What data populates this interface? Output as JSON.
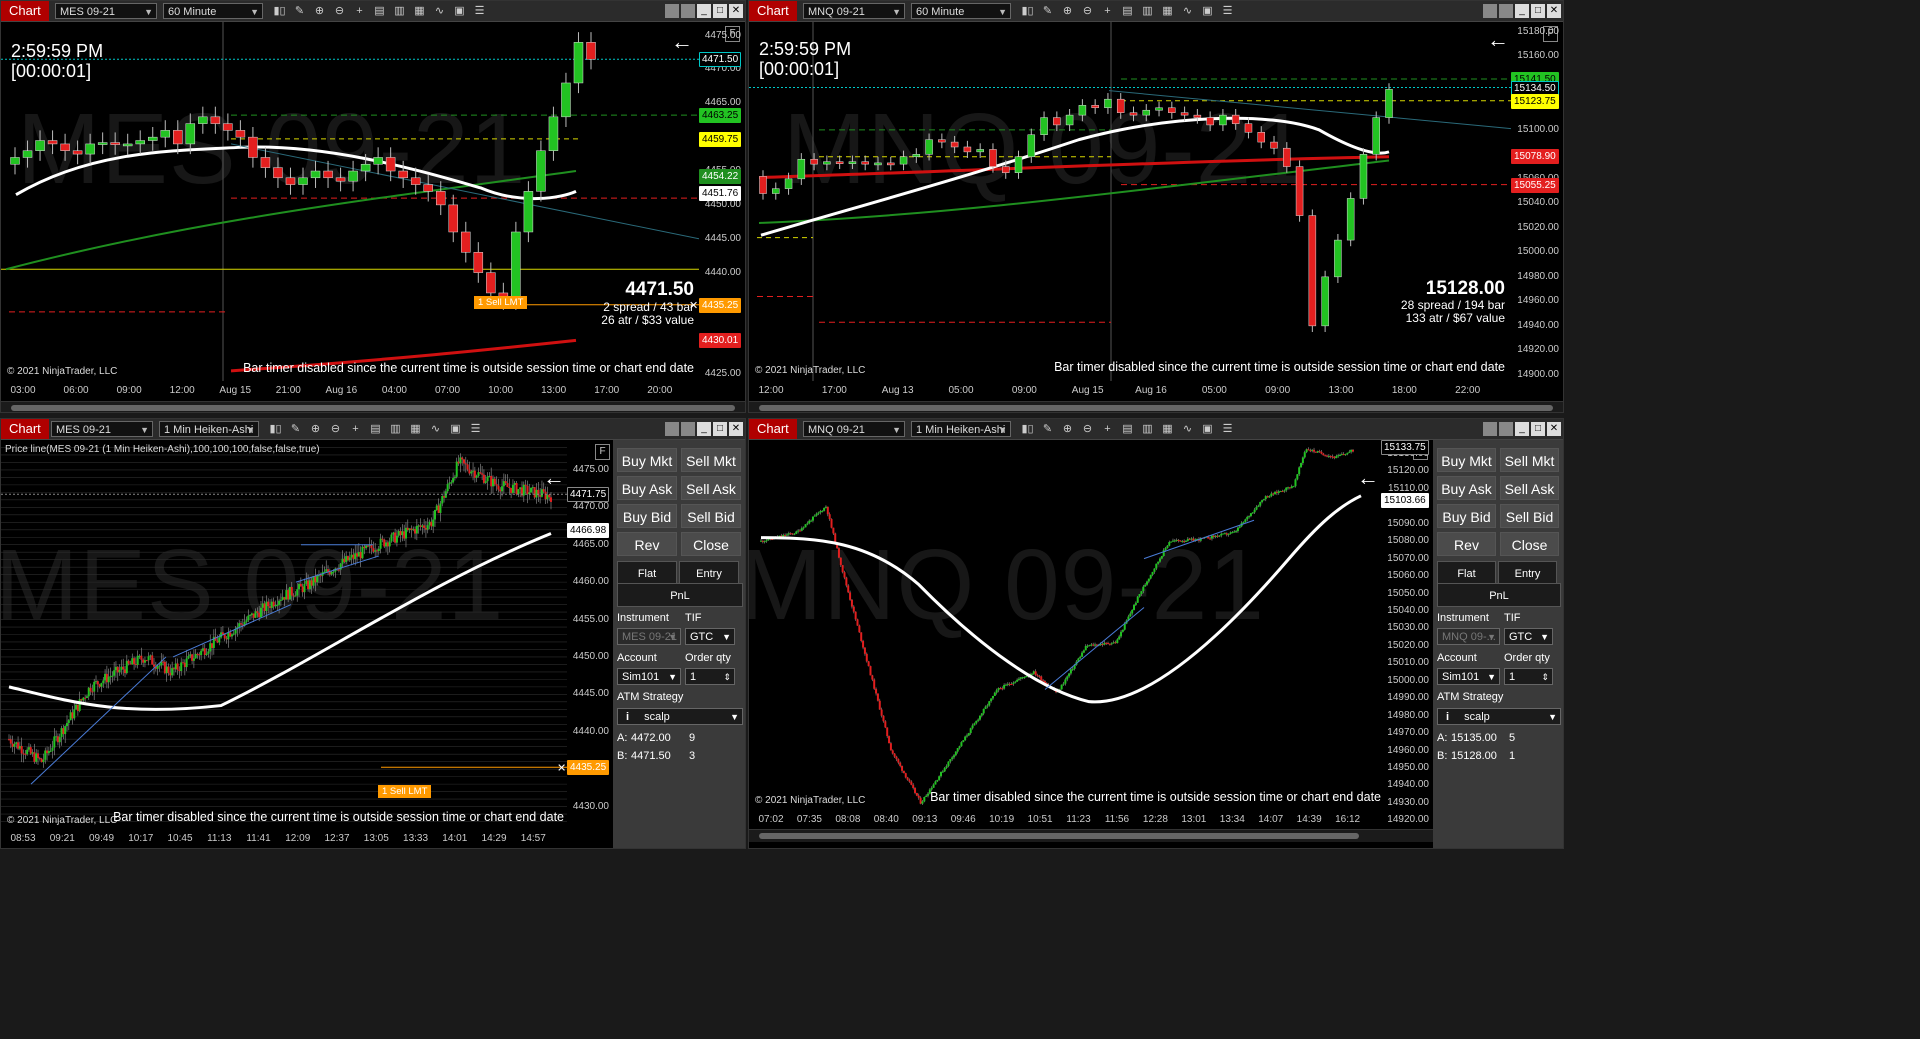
{
  "colors": {
    "up": "#22c322",
    "down": "#e31f1f",
    "accent": "#b00000",
    "order": "#ff9a00",
    "sma": "#ffffff",
    "green_line": "#1f8f1f",
    "red_line": "#d01010",
    "yellow": "#d7d700",
    "cyan": "#00c8c8"
  },
  "toolbar_icons": [
    "bar-type-icon",
    "pencil-icon",
    "zoom-in-icon",
    "zoom-out-icon",
    "crosshair-icon",
    "properties-icon",
    "templates-icon",
    "strategies-icon",
    "indicators-icon",
    "data-box-icon",
    "list-icon"
  ],
  "panels": [
    {
      "title": "Chart",
      "instrument": "MES 09-21",
      "period": "60 Minute",
      "clock": "2:59:59 PM",
      "countdown": "[00:00:01]",
      "watermark": "MES 09-21",
      "last_price": "4471.50",
      "spread_info": "2 spread / 43 bar",
      "atr_info": "26 atr / $33 value",
      "copyright": "© 2021 NinjaTrader, LLC",
      "bar_timer": "Bar timer disabled since the current time is outside session time or chart end date",
      "order_label": "1 Sell LMT",
      "y_ticks": [
        "4475.00",
        "4470.00",
        "4465.00",
        "4460.00",
        "4455.00",
        "4450.00",
        "4445.00",
        "4440.00",
        "4435.00",
        "4430.00",
        "4425.00"
      ],
      "x_ticks": [
        "03:00",
        "06:00",
        "09:00",
        "12:00",
        "Aug 15",
        "21:00",
        "Aug 16",
        "04:00",
        "07:00",
        "10:00",
        "13:00",
        "17:00",
        "20:00"
      ],
      "price_tags": [
        {
          "label": "4471.50",
          "value": 4471.5,
          "bg": "#000",
          "fg": "#fff",
          "border": "#00c8c8"
        },
        {
          "label": "4463.25",
          "value": 4463.25,
          "bg": "#22c322",
          "fg": "#000",
          "border": "#22c322"
        },
        {
          "label": "4459.75",
          "value": 4459.75,
          "bg": "#ffff00",
          "fg": "#000",
          "border": "#ffff00"
        },
        {
          "label": "4454.22",
          "value": 4454.22,
          "bg": "#1f8f1f",
          "fg": "#fff",
          "border": "#1f8f1f"
        },
        {
          "label": "4451.76",
          "value": 4451.76,
          "bg": "#fff",
          "fg": "#000",
          "border": "#fff"
        },
        {
          "label": "4435.25",
          "value": 4435.25,
          "bg": "#ff9a00",
          "fg": "#fff",
          "border": "#ff9a00"
        },
        {
          "label": "4430.01",
          "value": 4430.01,
          "bg": "#e31f1f",
          "fg": "#fff",
          "border": "#e31f1f"
        }
      ]
    },
    {
      "title": "Chart",
      "instrument": "MNQ 09-21",
      "period": "60 Minute",
      "clock": "2:59:59 PM",
      "countdown": "[00:00:01]",
      "watermark": "MNQ 09-21",
      "last_price": "15128.00",
      "spread_info": "28 spread / 194 bar",
      "atr_info": "133 atr / $67 value",
      "copyright": "© 2021 NinjaTrader, LLC",
      "bar_timer": "Bar timer disabled since the current time is outside session time or chart end date",
      "y_ticks": [
        "15180.00",
        "15160.00",
        "15120.00",
        "15100.00",
        "15060.00",
        "15040.00",
        "15020.00",
        "15000.00",
        "14980.00",
        "14960.00",
        "14940.00",
        "14920.00",
        "14900.00"
      ],
      "x_ticks": [
        "12:00",
        "17:00",
        "Aug 13",
        "05:00",
        "09:00",
        "Aug 15",
        "Aug 16",
        "05:00",
        "09:00",
        "13:00",
        "18:00",
        "22:00"
      ],
      "price_tags": [
        {
          "label": "15141.50",
          "value": 15141.5,
          "bg": "#22c322",
          "fg": "#000",
          "border": "#22c322"
        },
        {
          "label": "15134.50",
          "value": 15134.5,
          "bg": "#000",
          "fg": "#fff",
          "border": "#00c8c8"
        },
        {
          "label": "15123.75",
          "value": 15123.75,
          "bg": "#ffff00",
          "fg": "#000",
          "border": "#ffff00"
        },
        {
          "label": "15078.90",
          "value": 15078.9,
          "bg": "#e31f1f",
          "fg": "#fff",
          "border": "#e31f1f"
        },
        {
          "label": "15055.25",
          "value": 15055.25,
          "bg": "#e31f1f",
          "fg": "#fff",
          "border": "#e31f1f"
        }
      ]
    },
    {
      "title": "Chart",
      "instrument": "MES 09-21",
      "period": "1 Min Heiken-Ashi",
      "indicator_label": "Price line(MES 09-21 (1 Min Heiken-Ashi),100,100,100,false,false,true)",
      "watermark": "MES 09-21",
      "copyright": "© 2021 NinjaTrader, LLC",
      "bar_timer": "Bar timer disabled since the current time is outside session time or chart end date",
      "order_label": "1 Sell LMT",
      "y_ticks": [
        "4475.00",
        "4470.00",
        "4465.00",
        "4460.00",
        "4455.00",
        "4450.00",
        "4445.00",
        "4440.00",
        "4435.00",
        "4430.00"
      ],
      "x_ticks": [
        "08:53",
        "09:21",
        "09:49",
        "10:17",
        "10:45",
        "11:13",
        "11:41",
        "12:09",
        "12:37",
        "13:05",
        "13:33",
        "14:01",
        "14:29",
        "14:57"
      ],
      "price_tags": [
        {
          "label": "4471.75",
          "value": 4471.75,
          "bg": "#000",
          "fg": "#fff",
          "border": "#888"
        },
        {
          "label": "4466.98",
          "value": 4466.98,
          "bg": "#fff",
          "fg": "#000",
          "border": "#fff"
        },
        {
          "label": "4435.25",
          "value": 4435.25,
          "bg": "#ff9a00",
          "fg": "#fff",
          "border": "#ff9a00"
        }
      ],
      "order_panel": {
        "buttons": [
          [
            "Buy Mkt",
            "Sell Mkt"
          ],
          [
            "Buy Ask",
            "Sell Ask"
          ],
          [
            "Buy Bid",
            "Sell Bid"
          ],
          [
            "Rev",
            "Close"
          ]
        ],
        "position_buttons": [
          "Flat",
          "Entry"
        ],
        "pnl_label": "PnL",
        "instrument_label": "Instrument",
        "tif_label": "TIF",
        "instrument_value": "MES 09-21",
        "tif_value": "GTC",
        "account_label": "Account",
        "qty_label": "Order qty",
        "account_value": "Sim101",
        "qty_value": "1",
        "atm_label": "ATM Strategy",
        "atm_value": "scalp",
        "ask_label": "A:",
        "ask_price": "4472.00",
        "ask_size": "9",
        "bid_label": "B:",
        "bid_price": "4471.50",
        "bid_size": "3"
      }
    },
    {
      "title": "Chart",
      "instrument": "MNQ 09-21",
      "period": "1 Min Heiken-Ashi",
      "watermark": "MNQ 09-21",
      "copyright": "© 2021 NinjaTrader, LLC",
      "bar_timer": "Bar timer disabled since the current time is outside session time or chart end date",
      "y_ticks": [
        "15130.00",
        "15120.00",
        "15110.00",
        "15100.00",
        "15090.00",
        "15080.00",
        "15070.00",
        "15060.00",
        "15050.00",
        "15040.00",
        "15030.00",
        "15020.00",
        "15010.00",
        "15000.00",
        "14990.00",
        "14980.00",
        "14970.00",
        "14960.00",
        "14950.00",
        "14940.00",
        "14930.00",
        "14920.00"
      ],
      "x_ticks": [
        "07:02",
        "07:35",
        "08:08",
        "08:40",
        "09:13",
        "09:46",
        "10:19",
        "10:51",
        "11:23",
        "11:56",
        "12:28",
        "13:01",
        "13:34",
        "14:07",
        "14:39",
        "16:12"
      ],
      "price_tags": [
        {
          "label": "15133.75",
          "value": 15133.75,
          "bg": "#000",
          "fg": "#fff",
          "border": "#888"
        },
        {
          "label": "15103.66",
          "value": 15103.66,
          "bg": "#fff",
          "fg": "#000",
          "border": "#fff"
        }
      ],
      "order_panel": {
        "buttons": [
          [
            "Buy Mkt",
            "Sell Mkt"
          ],
          [
            "Buy Ask",
            "Sell Ask"
          ],
          [
            "Buy Bid",
            "Sell Bid"
          ],
          [
            "Rev",
            "Close"
          ]
        ],
        "position_buttons": [
          "Flat",
          "Entry"
        ],
        "pnl_label": "PnL",
        "instrument_label": "Instrument",
        "tif_label": "TIF",
        "instrument_value": "MNQ 09-...",
        "tif_value": "GTC",
        "account_label": "Account",
        "qty_label": "Order qty",
        "account_value": "Sim101",
        "qty_value": "1",
        "atm_label": "ATM Strategy",
        "atm_value": "scalp",
        "ask_label": "A:",
        "ask_price": "15135.00",
        "ask_size": "5",
        "bid_label": "B:",
        "bid_price": "15128.00",
        "bid_size": "1"
      }
    }
  ]
}
